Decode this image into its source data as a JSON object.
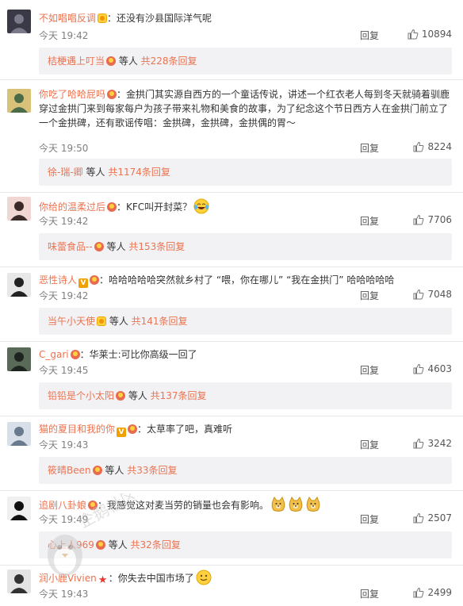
{
  "comments": [
    {
      "username": "不如唱唱反调",
      "badge": "vip",
      "text": "：还没有沙县国际洋气呢",
      "time": "今天 19:42",
      "reply_label": "回复",
      "likes": "10894",
      "sub": {
        "name": "桔梗遇上叮当",
        "badge": "fan",
        "suffix": "等人",
        "more": "共228条回复"
      },
      "avatar_colors": [
        "#3a3a46",
        "#7a7a8a"
      ],
      "emoji": null
    },
    {
      "username": "你吃了哈哈屁吗",
      "badge": "fan",
      "text": "：金拱门其实源自西方的一个童话传说，讲述一个红衣老人每到冬天就骑着驯鹿穿过金拱门来到每家每户为孩子带来礼物和美食的故事，为了纪念这个节日西方人在金拱门前立了一个金拱碑，还有歌谣传唱：金拱碑，金拱碑，金拱偶的胃～",
      "time": "今天 19:50",
      "reply_label": "回复",
      "likes": "8224",
      "sub": {
        "name": "徐-瑞-卿",
        "badge": null,
        "suffix": "等人",
        "more": "共1174条回复"
      },
      "avatar_colors": [
        "#d8c27a",
        "#4a6a48"
      ],
      "emoji": null
    },
    {
      "username": "你给的温柔过后",
      "badge": "fan",
      "text": "：KFC叫开封菜？",
      "time": "今天 19:42",
      "reply_label": "回复",
      "likes": "7706",
      "sub": {
        "name": "味蕾食品--",
        "badge": "fan",
        "suffix": "等人",
        "more": "共153条回复"
      },
      "avatar_colors": [
        "#f1d7d3",
        "#3a2a28"
      ],
      "emoji": "laugh-cry"
    },
    {
      "username": "恶性诗人",
      "badge": "v-fan",
      "text": "：哈哈哈哈哈突然就乡村了 “喂，你在哪儿” “我在金拱门” 哈哈哈哈哈",
      "time": "今天 19:42",
      "reply_label": "回复",
      "likes": "7048",
      "sub": {
        "name": "当午小天使",
        "badge": "vip",
        "suffix": "等人",
        "more": "共141条回复"
      },
      "avatar_colors": [
        "#e8e8e8",
        "#222222"
      ],
      "emoji": null
    },
    {
      "username": "C_gari",
      "badge": "fan",
      "text": "：华莱士:可比你高级一回了",
      "time": "今天 19:45",
      "reply_label": "回复",
      "likes": "4603",
      "sub": {
        "name": "铅铅是个小太阳",
        "badge": "fan",
        "suffix": "等人",
        "more": "共137条回复"
      },
      "avatar_colors": [
        "#5a6a58",
        "#1e2420"
      ],
      "emoji": null
    },
    {
      "username": "猫的夏目和我的你",
      "badge": "v-fan",
      "text": "：太草率了吧，真难听",
      "time": "今天 19:43",
      "reply_label": "回复",
      "likes": "3242",
      "sub": {
        "name": "筱晴Been",
        "badge": "fan",
        "suffix": "等人",
        "more": "共33条回复"
      },
      "avatar_colors": [
        "#d9dfe8",
        "#6a7a8e"
      ],
      "emoji": null
    },
    {
      "username": "追剧八卦娘",
      "badge": "fan",
      "text": "：我感觉这对麦当劳的销量也会有影响。",
      "time": "今天 19:49",
      "reply_label": "回复",
      "likes": "2507",
      "sub": {
        "name": "心上人969",
        "badge": "fan",
        "suffix": "等人",
        "more": "共32条回复"
      },
      "avatar_colors": [
        "#f0f0f0",
        "#111111"
      ],
      "emoji": "doge-x3"
    },
    {
      "username": "润小鹿Vivien",
      "badge": "star",
      "text": "：你失去中国市场了",
      "time": "今天 19:43",
      "reply_label": "回复",
      "likes": "2499",
      "sub": null,
      "avatar_colors": [
        "#e4e4e4",
        "#333333"
      ],
      "emoji": "smile"
    }
  ],
  "watermark": {
    "text": "企鹅社区"
  },
  "colors": {
    "username": "#eb7350",
    "subbox_bg": "#f2f2f5",
    "meta": "#808080"
  }
}
